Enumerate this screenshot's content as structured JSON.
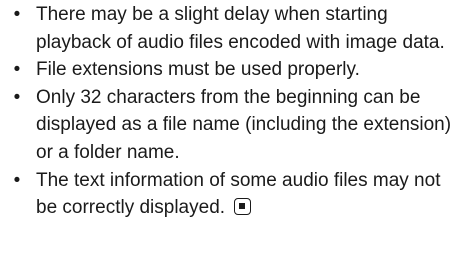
{
  "document": {
    "items": [
      {
        "bullet": "•",
        "text": "There may be a slight delay when starting playback of audio files encoded with image data."
      },
      {
        "bullet": "•",
        "text": "File extensions must be used properly."
      },
      {
        "bullet": "•",
        "text": "Only 32 characters from the beginning can be displayed as a file name (including the extension) or a folder name."
      },
      {
        "bullet": "•",
        "text": "The text information of some audio files may not be correctly displayed."
      }
    ],
    "end_mark_icon": "square-end-mark-icon"
  }
}
